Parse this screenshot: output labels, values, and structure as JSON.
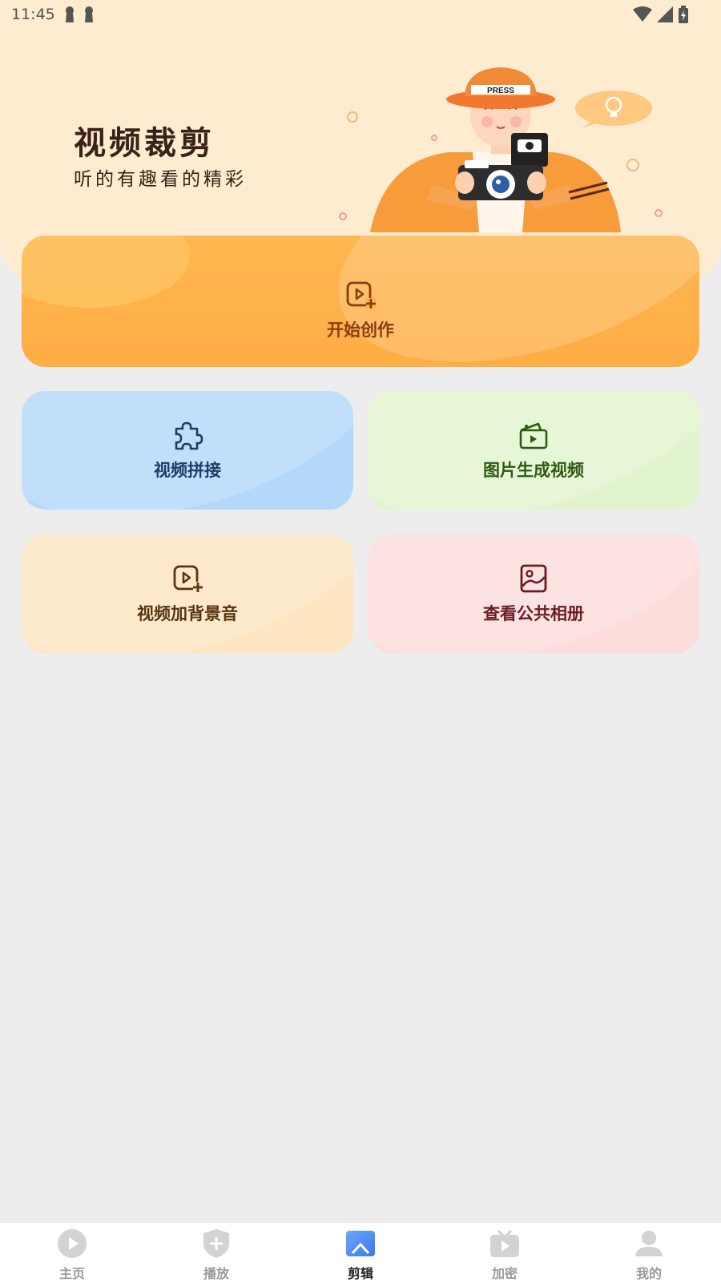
{
  "status_bar": {
    "time": "11:45",
    "icons": [
      "notification-pin-icon",
      "notification-pin-icon",
      "wifi-icon",
      "signal-icon",
      "battery-charging-icon"
    ]
  },
  "banner": {
    "title": "视频裁剪",
    "subtitle": "听的有趣看的精彩",
    "hat_text": "PRESS",
    "illustration": "photographer-with-camera"
  },
  "cards": {
    "main": {
      "label": "开始创作",
      "icon": "video-add-icon",
      "color": "#ffb04a"
    },
    "splice": {
      "label": "视频拼接",
      "icon": "puzzle-icon",
      "color": "#b4d8f9"
    },
    "photo_to_video": {
      "label": "图片生成视频",
      "icon": "photo-video-icon",
      "color": "#e2f4ce"
    },
    "bgm": {
      "label": "视频加背景音",
      "icon": "video-add-icon",
      "color": "#fde6c1"
    },
    "album": {
      "label": "查看公共相册",
      "icon": "image-icon",
      "color": "#fddcdc"
    }
  },
  "bottom_nav": {
    "items": [
      {
        "label": "主页",
        "icon": "play-circle-icon",
        "active": false
      },
      {
        "label": "播放",
        "icon": "shield-plus-icon",
        "active": false
      },
      {
        "label": "剪辑",
        "icon": "edit-screen-icon",
        "active": true
      },
      {
        "label": "加密",
        "icon": "tv-play-icon",
        "active": false
      },
      {
        "label": "我的",
        "icon": "user-icon",
        "active": false
      }
    ],
    "active_color": "#4a86f0"
  }
}
